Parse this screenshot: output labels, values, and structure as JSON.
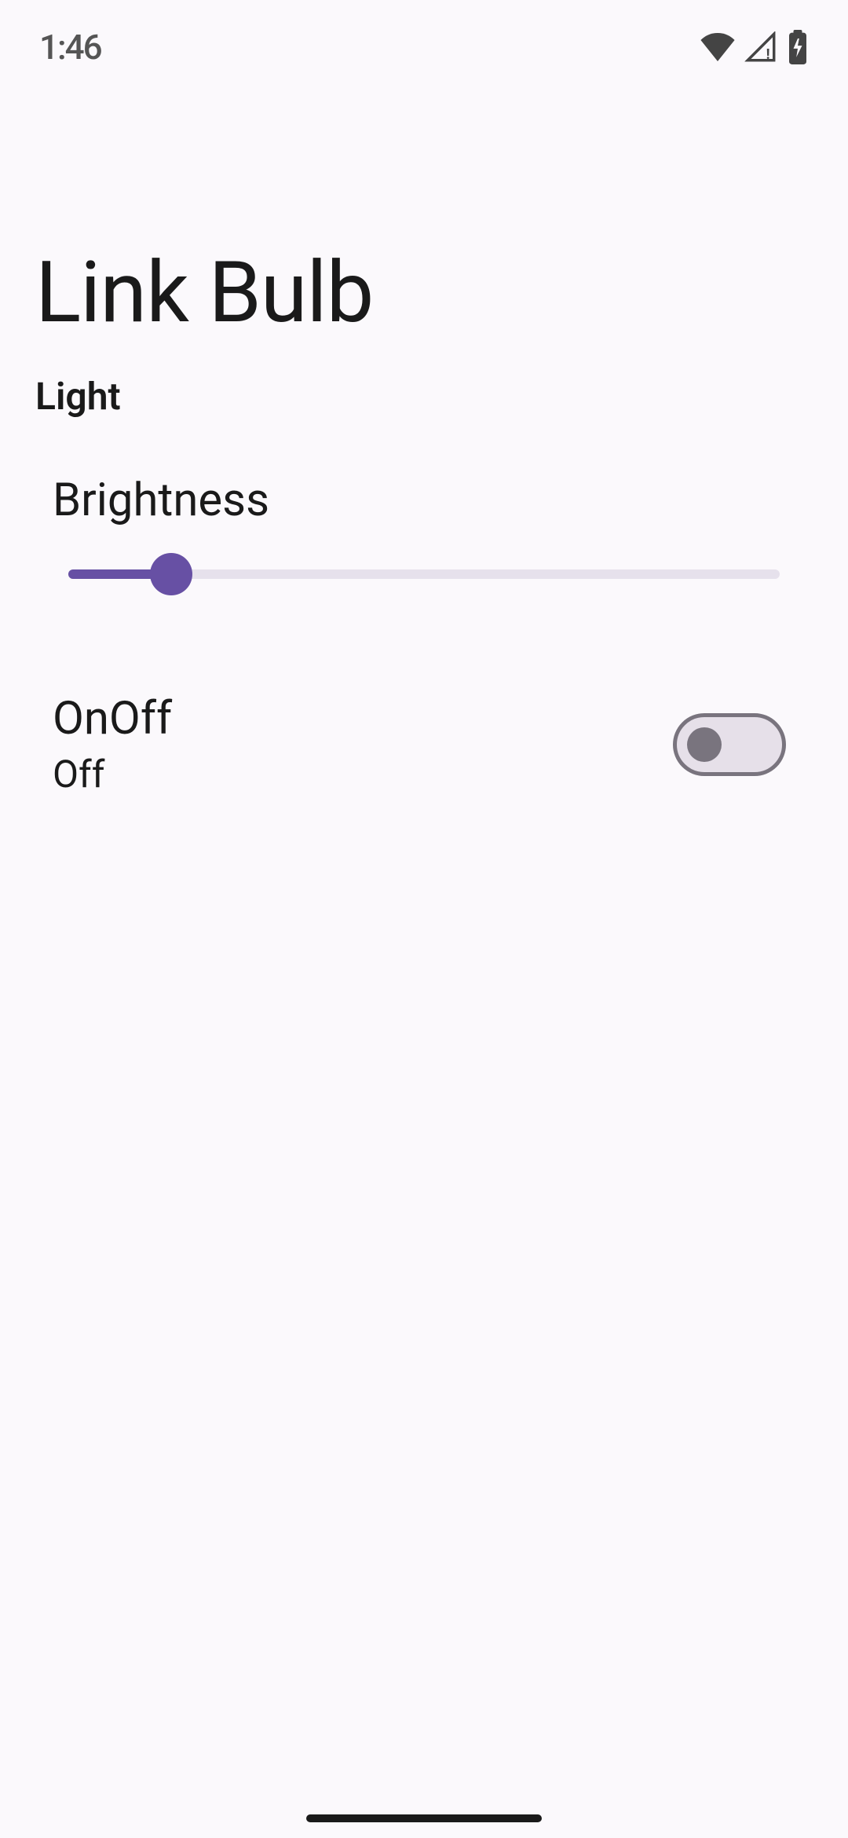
{
  "status_bar": {
    "time": "1:46"
  },
  "page": {
    "title": "Link Bulb",
    "subtitle": "Light"
  },
  "brightness": {
    "label": "Brightness",
    "value_percent": 16
  },
  "onoff": {
    "title": "OnOff",
    "status": "Off",
    "value": false
  },
  "colors": {
    "accent": "#6750a4",
    "track": "#e6e1ec",
    "toggle_border": "#79747e",
    "toggle_bg": "#e6e0e9"
  }
}
